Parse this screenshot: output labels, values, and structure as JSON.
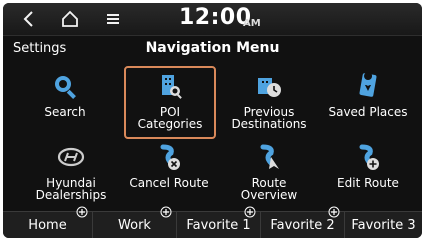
{
  "status": {
    "back_icon": "chevron-left-icon",
    "home_icon": "home-icon",
    "menu_icon": "menu-icon",
    "time": "12:00",
    "ampm": "AM"
  },
  "header": {
    "settings": "Settings",
    "title": "Navigation Menu"
  },
  "menu_items": [
    {
      "label": "Search",
      "icon": "search-icon",
      "selected": false
    },
    {
      "label": "POI\nCategories",
      "icon": "poi-categories-icon",
      "selected": true
    },
    {
      "label": "Previous\nDestinations",
      "icon": "previous-destinations-icon",
      "selected": false
    },
    {
      "label": "Saved Places",
      "icon": "saved-places-icon",
      "selected": false
    },
    {
      "label": "Hyundai\nDealerships",
      "icon": "hyundai-logo-icon",
      "selected": false
    },
    {
      "label": "Cancel Route",
      "icon": "cancel-route-icon",
      "selected": false
    },
    {
      "label": "Route\nOverview",
      "icon": "route-overview-icon",
      "selected": false
    },
    {
      "label": "Edit Route",
      "icon": "edit-route-icon",
      "selected": false
    }
  ],
  "favorites": [
    {
      "label": "Home"
    },
    {
      "label": "Work"
    },
    {
      "label": "Favorite 1"
    },
    {
      "label": "Favorite 2"
    },
    {
      "label": "Favorite 3"
    }
  ],
  "colors": {
    "background": "#111111",
    "highlight_border": "#d9895a",
    "icon_blue": "#4fa3e0"
  }
}
